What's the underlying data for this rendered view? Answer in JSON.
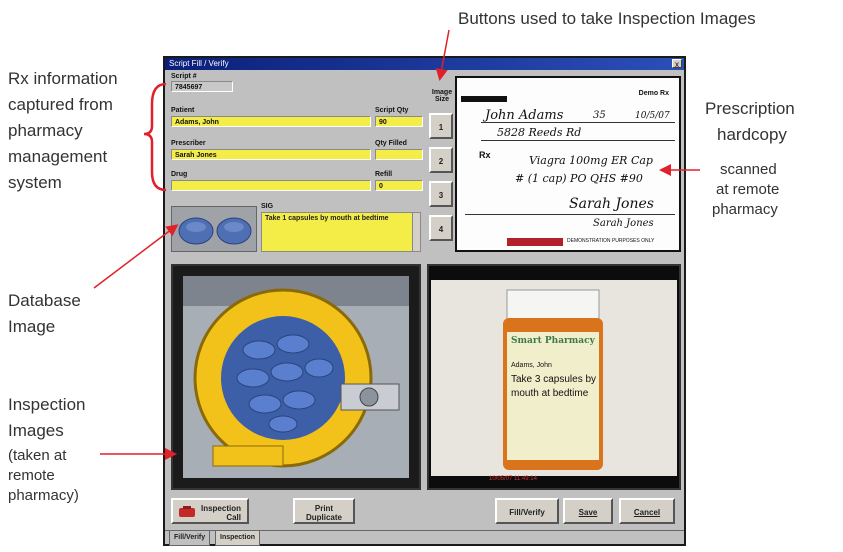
{
  "callouts": {
    "top": "Buttons used to take Inspection Images",
    "rx_info": [
      "Rx information",
      "captured from",
      "pharmacy",
      "management",
      "system"
    ],
    "database_image": [
      "Database",
      "Image"
    ],
    "inspection_images": [
      "Inspection",
      "Images"
    ],
    "inspection_note": [
      "(taken at",
      "remote",
      "pharmacy)"
    ],
    "prescription": [
      "Prescription",
      "hardcopy"
    ],
    "prescription_note": [
      "scanned",
      "at remote",
      "pharmacy"
    ]
  },
  "window": {
    "title": "Script Fill / Verify",
    "close": "x",
    "script_label": "Script #",
    "script_value": "7845697",
    "patient_label": "Patient",
    "patient_value": "Adams, John",
    "script_qty_label": "Script Qty",
    "script_qty_value": "90",
    "prescriber_label": "Prescriber",
    "prescriber_value": "Sarah Jones",
    "qty_filled_label": "Qty Filled",
    "drug_label": "Drug",
    "refill_label": "Refill",
    "refill_value": "0",
    "sig_label": "SIG",
    "sig_value": "Take 1 capsules by mouth at bedtime",
    "image_size_label": [
      "Image",
      "Size"
    ],
    "image_buttons": [
      "1",
      "2",
      "3",
      "4"
    ]
  },
  "rx_doc": {
    "header": "Demo Rx",
    "patient_name": "John Adams",
    "age": "35",
    "date": "10/5/07",
    "address": "5828 Reeds Rd",
    "rx_mark": "Rx",
    "line1": "Viagra 100mg ER Cap",
    "line2": "# (1 cap) PO QHS #90",
    "signature": "Sarah Jones",
    "printed_name": "Sarah Jones",
    "footer": "DEMONSTRATION PURPOSES ONLY"
  },
  "bottle": {
    "pharmacy": "Smart Pharmacy",
    "patient": "Adams, John",
    "line1": "Take 3 capsules by",
    "line2": "mouth at bedtime",
    "timestamp": "10/05/07 11:49:14"
  },
  "buttons": {
    "inspection_call": [
      "Inspection",
      "Call"
    ],
    "print_duplicate": [
      "Print",
      "Duplicate"
    ],
    "fill_verify": "Fill/Verify",
    "save": "Save",
    "cancel": "Cancel"
  },
  "tabs": [
    "Fill/Verify",
    "Inspection"
  ],
  "colors": {
    "field": "#f4ec47",
    "title": "#0b1f7a",
    "arrow": "#e0202a",
    "pill": "#4f6fb5"
  }
}
